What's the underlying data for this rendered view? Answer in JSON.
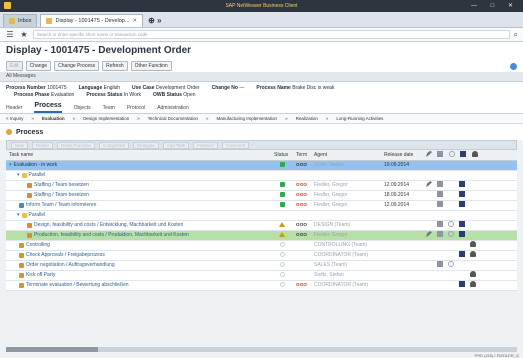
{
  "window": {
    "title": "SAP NetWeaver Business Client",
    "controls": "— □ ✕"
  },
  "browser": {
    "tabs": [
      {
        "label": "Inbox",
        "active": false
      },
      {
        "label": "Display - 1001475 - Develop...",
        "active": true
      }
    ],
    "tabs_nav": "⊕ »",
    "address_placeholder": "Search or enter specific short name or transaction code"
  },
  "app": {
    "title": "Display - 1001475 - Development Order",
    "toolbar": {
      "edit": "Edit",
      "change": "Change",
      "change_process": "Change Process",
      "refresh": "Refresh",
      "other_function": "Other Function"
    },
    "messages_label": "All Messages"
  },
  "header": {
    "process_number_label": "Process Number",
    "process_number": "1001475",
    "language_label": "Language",
    "language": "English",
    "use_case_label": "Use Case",
    "use_case": "Development Order",
    "change_no_label": "Change No",
    "change_no": "—",
    "process_name_label": "Process Name",
    "process_name": "Brake Disc is weak",
    "process_phase_label": "Process Phase",
    "process_phase": "Evaluation",
    "process_status_label": "Process Status",
    "process_status": "In Work",
    "owb_status_label": "OWB Status",
    "owb_status": "Open"
  },
  "detail_tabs": [
    "Header",
    "Process",
    "Objects",
    "Team",
    "Protocol",
    "Administration"
  ],
  "phases": [
    "< Inquiry",
    "Evaluation",
    "Design Implementation",
    "Technical Documentation",
    "Manufacturing Implementation",
    "Realization",
    "Long-Running Activities"
  ],
  "section_title": "Process",
  "grid_toolbar": [
    "New",
    "Delete",
    "Detail Function",
    "Completed",
    "Delegate",
    "Add Task",
    "Forward",
    "Comment"
  ],
  "columns": [
    "Task name",
    "Status",
    "Term",
    "Agent",
    "Release date",
    "",
    "",
    "",
    "",
    ""
  ],
  "rows": [
    {
      "name": "Evaluation - in work",
      "indent": 0,
      "style": "hl",
      "icon": "tri",
      "status": "green",
      "term": "OOO",
      "term_style": "ok",
      "agent": "Stoltz, Stefan",
      "release": "19.09.2014",
      "icons": []
    },
    {
      "name": "Parallel",
      "indent": 1,
      "style": "norm",
      "icon": "folder",
      "status": "",
      "term": "",
      "term_style": "",
      "agent": "",
      "release": "",
      "icons": []
    },
    {
      "name": "Staffing / Team besetzen",
      "indent": 2,
      "style": "norm",
      "icon": "orange",
      "status": "green",
      "term": "OOO",
      "term_style": "red",
      "agent": "Fiedler, Gregor",
      "release": "12.09.2014",
      "icons": [
        "pen",
        "doc",
        "",
        "grid",
        ""
      ]
    },
    {
      "name": "Staffing / Team besetzen",
      "indent": 2,
      "style": "norm",
      "icon": "orange",
      "status": "green",
      "term": "OOO",
      "term_style": "red",
      "agent": "Fiedler, Gregor",
      "release": "18.09.2014",
      "icons": [
        "",
        "doc",
        "",
        "grid",
        ""
      ]
    },
    {
      "name": "Inform Team / Team informieren",
      "indent": 1,
      "style": "norm",
      "icon": "blue",
      "status": "green",
      "term": "OOO",
      "term_style": "red",
      "agent": "Fiedler, Gregor",
      "release": "12.09.2014",
      "icons": [
        "",
        "doc",
        "",
        "grid",
        ""
      ]
    },
    {
      "name": "Parallel",
      "indent": 1,
      "style": "norm",
      "icon": "folder",
      "status": "",
      "term": "",
      "term_style": "",
      "agent": "",
      "release": "",
      "icons": []
    },
    {
      "name": "Design, feasibility and costs / Entwicklung, Machbarkeit und Kosten",
      "indent": 2,
      "style": "norm",
      "icon": "orange",
      "status": "warn",
      "term": "OOO",
      "term_style": "ok",
      "agent": "DESIGN (Team)",
      "release": "",
      "icons": [
        "",
        "doc",
        "clip",
        "grid",
        ""
      ]
    },
    {
      "name": "Production, feasibility and costs / Produktion, Machbarkeit und Kosten",
      "indent": 2,
      "style": "green",
      "icon": "orange",
      "status": "warn",
      "term": "OOO",
      "term_style": "ok",
      "agent": "Fiedler, Gregor",
      "release": "",
      "icons": [
        "pen",
        "doc",
        "clip",
        "grid",
        ""
      ]
    },
    {
      "name": "Controlling",
      "indent": 1,
      "style": "norm",
      "icon": "gold",
      "status": "empty",
      "term": "",
      "term_style": "",
      "agent": "CONTROLLING (Team)",
      "release": "",
      "icons": [
        "",
        "",
        "",
        "",
        "user"
      ]
    },
    {
      "name": "Check Approvals / Freigabeprozess",
      "indent": 1,
      "style": "norm",
      "icon": "gold",
      "status": "empty",
      "term": "",
      "term_style": "",
      "agent": "COORDINATOR (Team)",
      "release": "",
      "icons": [
        "",
        "",
        "",
        "grid",
        "user"
      ]
    },
    {
      "name": "Order negotiation / Auftragsverhandlung",
      "indent": 1,
      "style": "norm",
      "icon": "gold",
      "status": "empty",
      "term": "",
      "term_style": "",
      "agent": "SALES (Team)",
      "release": "",
      "icons": [
        "",
        "doc",
        "clip",
        "",
        ""
      ]
    },
    {
      "name": "Kick off Party",
      "indent": 1,
      "style": "norm",
      "icon": "gold",
      "status": "empty",
      "term": "",
      "term_style": "",
      "agent": "Stoltz, Stefan",
      "release": "",
      "icons": [
        "",
        "",
        "",
        "",
        "user"
      ]
    },
    {
      "name": "Terminate evaluation / Bewertung abschließen",
      "indent": 1,
      "style": "norm",
      "icon": "gold",
      "status": "empty",
      "term": "OOO",
      "term_style": "red",
      "agent": "COORDINATOR (Team)",
      "release": "",
      "icons": [
        "",
        "",
        "",
        "grid",
        "user"
      ]
    }
  ],
  "footer_code": "PRD (100) / FIEDLER_G"
}
